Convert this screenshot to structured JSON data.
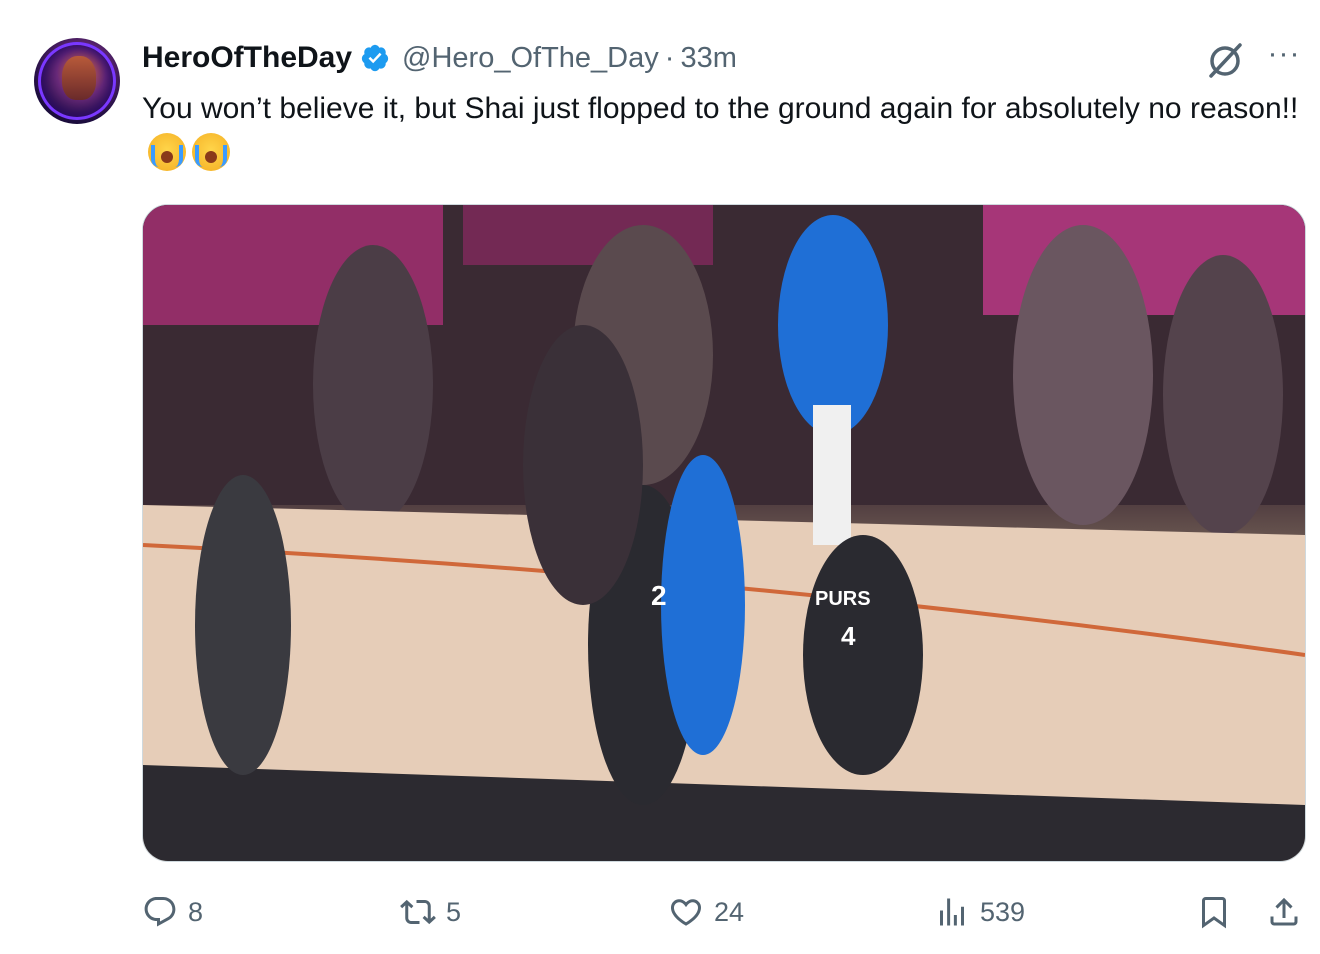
{
  "post": {
    "display_name": "HeroOfTheDay",
    "handle": "@Hero_OfThe_Day",
    "separator": "·",
    "time": "33m",
    "text": "You won’t believe it, but Shai just flopped to the ground again for absolutely no reason!!",
    "emojis": [
      "loudly-crying-face",
      "loudly-crying-face"
    ],
    "verified": true,
    "media": {
      "description_icons": [
        "spurs-jersey-4",
        "spurs-jersey-2",
        "thunder-jersey-0"
      ],
      "jersey_texts": [
        "PURS",
        "4",
        "2"
      ]
    }
  },
  "header_icons": [
    "grok-icon",
    "more-icon"
  ],
  "more_glyph": "···",
  "actions": {
    "reply_count": "8",
    "retweet_count": "5",
    "like_count": "24",
    "views_count": "539"
  },
  "colors": {
    "verified": "#1d9bf0",
    "secondary_text": "#536471",
    "primary_text": "#0f1419"
  }
}
